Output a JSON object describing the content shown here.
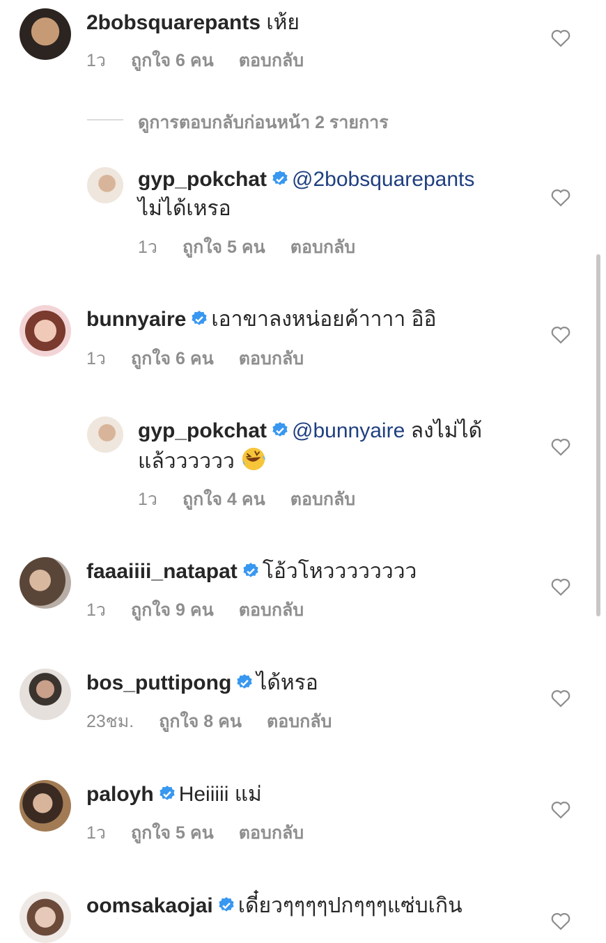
{
  "view_previous_replies": "ดูการตอบกลับก่อนหน้า 2 รายการ",
  "comments": [
    {
      "user": "2bobsquarepants",
      "text": "เห้ย",
      "time": "1ว",
      "likes": "ถูกใจ 6 คน",
      "reply": "ตอบกลับ"
    },
    {
      "user": "gyp_pokchat",
      "mention": "@2bobsquarepants",
      "line2": "ไม่ได้เหรอ",
      "time": "1ว",
      "likes": "ถูกใจ 5 คน",
      "reply": "ตอบกลับ"
    },
    {
      "user": "bunnyaire",
      "text": "เอาขาลงหน่อยค้าาาา อิอิ",
      "time": "1ว",
      "likes": "ถูกใจ 6 คน",
      "reply": "ตอบกลับ"
    },
    {
      "user": "gyp_pokchat",
      "mention": "@bunnyaire",
      "text": "ลงไม่ได้",
      "line2": "แล้วววววว",
      "time": "1ว",
      "likes": "ถูกใจ 4 คน",
      "reply": "ตอบกลับ"
    },
    {
      "user": "faaaiiii_natapat",
      "text": "โอ้วโหวววววววว",
      "time": "1ว",
      "likes": "ถูกใจ 9 คน",
      "reply": "ตอบกลับ"
    },
    {
      "user": "bos_puttipong",
      "text": "ได้หรอ",
      "time": "23ชม.",
      "likes": "ถูกใจ 8 คน",
      "reply": "ตอบกลับ"
    },
    {
      "user": "paloyh",
      "text": "Heiiiii แม่",
      "time": "1ว",
      "likes": "ถูกใจ 5 คน",
      "reply": "ตอบกลับ"
    },
    {
      "user": "oomsakaojai",
      "text": "เดี๋ยวๆๆๆๆปกๆๆๆแซ่บเกิน"
    }
  ],
  "colors": {
    "accent": "#1f3f80",
    "verified": "#3897f0",
    "meta": "#8e8e8e"
  }
}
